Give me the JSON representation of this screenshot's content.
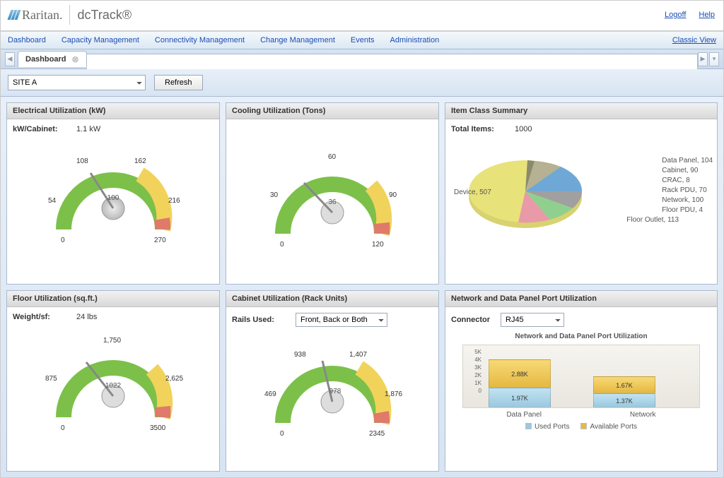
{
  "brand": {
    "company": "Raritan.",
    "product": "dcTrack®"
  },
  "toplinks": {
    "logoff": "Logoff",
    "help": "Help"
  },
  "nav": {
    "items": [
      "Dashboard",
      "Capacity Management",
      "Connectivity Management",
      "Change Management",
      "Events",
      "Administration"
    ],
    "classic": "Classic View"
  },
  "tabs": {
    "active": "Dashboard"
  },
  "filter": {
    "site": "SITE A",
    "refresh": "Refresh"
  },
  "panels": {
    "electrical": {
      "title": "Electrical Utilization (kW)",
      "metric_label": "kW/Cabinet:",
      "metric_value": "1.1 kW",
      "gauge": {
        "min": 0,
        "max": 270,
        "value": 100,
        "ticks": [
          0,
          54,
          108,
          162,
          216,
          270
        ]
      }
    },
    "cooling": {
      "title": "Cooling Utilization (Tons)",
      "gauge": {
        "min": 0,
        "max": 120,
        "value": 36,
        "ticks": [
          0,
          30,
          60,
          90,
          120
        ]
      }
    },
    "itemclass": {
      "title": "Item Class Summary",
      "total_label": "Total Items:",
      "total_value": "1000"
    },
    "floor": {
      "title": "Floor Utilization (sq.ft.)",
      "metric_label": "Weight/sf:",
      "metric_value": "24 lbs",
      "gauge": {
        "min": 0,
        "max": 3500,
        "value": 1022,
        "ticks": [
          0,
          875,
          1750,
          2625,
          3500
        ]
      }
    },
    "cabinet": {
      "title": "Cabinet Utilization (Rack Units)",
      "rails_label": "Rails Used:",
      "rails_value": "Front, Back or Both",
      "gauge": {
        "min": 0,
        "max": 2345,
        "value": 978,
        "ticks": [
          0,
          469,
          938,
          1407,
          1876,
          2345
        ]
      }
    },
    "ports": {
      "title": "Network and Data Panel Port Utilization",
      "connector_label": "Connector",
      "connector_value": "RJ45",
      "chart_title": "Network and Data Panel Port Utilization",
      "legend": {
        "used": "Used Ports",
        "available": "Available Ports"
      },
      "categories": [
        "Data Panel",
        "Network"
      ]
    }
  },
  "chart_data": [
    {
      "type": "pie",
      "title": "Item Class Summary",
      "total": 1000,
      "slices": [
        {
          "name": "Device",
          "value": 507,
          "color": "#e8e27a"
        },
        {
          "name": "Floor Outlet",
          "value": 113,
          "color": "#e89aa8"
        },
        {
          "name": "Data Panel",
          "value": 104,
          "color": "#6fa8d6"
        },
        {
          "name": "Network",
          "value": 100,
          "color": "#8fd08f"
        },
        {
          "name": "Cabinet",
          "value": 90,
          "color": "#b5b192"
        },
        {
          "name": "Rack PDU",
          "value": 70,
          "color": "#a0a0a0"
        },
        {
          "name": "CRAC",
          "value": 8,
          "color": "#8a8a6a"
        },
        {
          "name": "Floor PDU",
          "value": 4,
          "color": "#c7c7c7"
        }
      ]
    },
    {
      "type": "bar",
      "title": "Network and Data Panel Port Utilization",
      "categories": [
        "Data Panel",
        "Network"
      ],
      "series": [
        {
          "name": "Used Ports",
          "values": [
            1970,
            1370
          ],
          "labels": [
            "1.97K",
            "1.37K"
          ]
        },
        {
          "name": "Available Ports",
          "values": [
            2880,
            1670
          ],
          "labels": [
            "2.88K",
            "1.67K"
          ]
        }
      ],
      "ylim": [
        0,
        5000
      ],
      "yticks": [
        "0",
        "1K",
        "2K",
        "3K",
        "4K",
        "5K"
      ]
    }
  ]
}
